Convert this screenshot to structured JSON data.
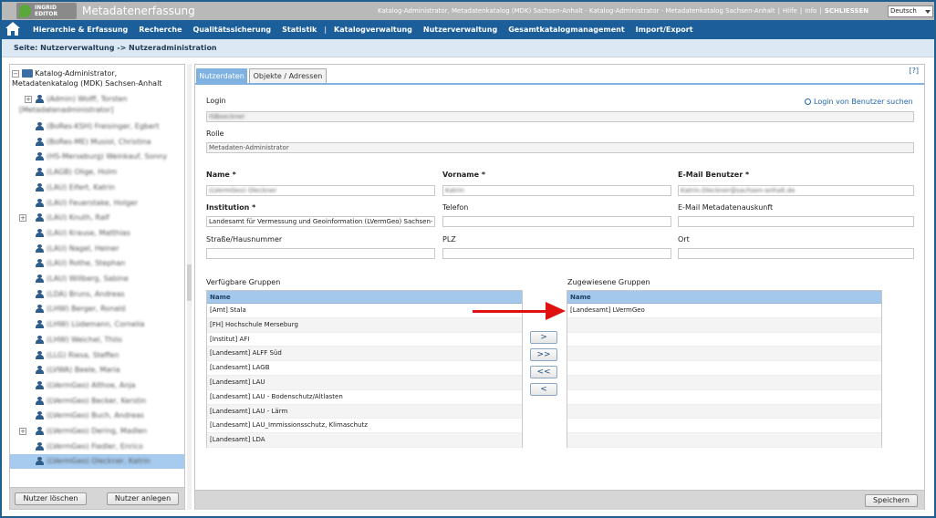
{
  "header": {
    "logo_line1": "INGRID",
    "logo_line2": "EDITOR",
    "app_title": "Metadatenerfassung",
    "user_info": "Katalog-Administrator, Metadatenkatalog (MDK) Sachsen-Anhalt - Katalog-Administrator - Metadatenkatalog Sachsen-Anhalt",
    "help_link": "Hilfe",
    "info_link": "Info",
    "close_link": "SCHLIESSEN",
    "language": "Deutsch"
  },
  "nav": {
    "items": [
      "Hierarchie & Erfassung",
      "Recherche",
      "Qualitätssicherung",
      "Statistik",
      "Katalogverwaltung",
      "Nutzerverwaltung",
      "Gesamtkatalogmanagement",
      "Import/Export"
    ]
  },
  "page": {
    "title": "Seite: Nutzerverwaltung -> Nutzeradministration"
  },
  "tree": {
    "root_label_1": "Katalog-Administrator,",
    "root_label_2": "Metadatenkatalog (MDK) Sachsen-Anhalt",
    "first_item_line1": "(Admin) Wolff, Torsten",
    "first_item_line2": "[Metadatenadministrator]",
    "items": [
      {
        "label": "(BoRes-KSH) Freisinger, Egbert",
        "expandable": false
      },
      {
        "label": "(BoRes-ME) Musiol, Christina",
        "expandable": false
      },
      {
        "label": "(HS-Merseburg) Weinkauf, Sonny",
        "expandable": false
      },
      {
        "label": "(LAGB) Olige, Holm",
        "expandable": false
      },
      {
        "label": "(LAU) Eifert, Katrin",
        "expandable": false
      },
      {
        "label": "(LAU) Feuerstake, Holger",
        "expandable": false
      },
      {
        "label": "(LAU) Knuth, Ralf",
        "expandable": true
      },
      {
        "label": "(LAU) Krause, Matthias",
        "expandable": false
      },
      {
        "label": "(LAU) Nagel, Heiner",
        "expandable": false
      },
      {
        "label": "(LAU) Rothe, Stephan",
        "expandable": false
      },
      {
        "label": "(LAU) Willberg, Sabine",
        "expandable": false
      },
      {
        "label": "(LDA) Bruns, Andreas",
        "expandable": false
      },
      {
        "label": "(LHW) Berger, Ronald",
        "expandable": false
      },
      {
        "label": "(LHW) Lüdemann, Cornelia",
        "expandable": false
      },
      {
        "label": "(LHW) Weichel, Thilo",
        "expandable": false
      },
      {
        "label": "(LLG) Riesa, Steffen",
        "expandable": false
      },
      {
        "label": "(LVWA) Beele, Maria",
        "expandable": false
      },
      {
        "label": "(LVermGeo) Althoe, Anja",
        "expandable": false
      },
      {
        "label": "(LVermGeo) Becker, Kerstin",
        "expandable": false
      },
      {
        "label": "(LVermGeo) Buch, Andreas",
        "expandable": false
      },
      {
        "label": "(LVermGeo) Dering, Madlen",
        "expandable": true
      },
      {
        "label": "(LVermGeo) Fiedler, Enrico",
        "expandable": false
      },
      {
        "label": "(LVermGeo) Oleckner, Katrin",
        "expandable": false,
        "selected": true
      }
    ],
    "delete_button": "Nutzer löschen",
    "create_button": "Nutzer anlegen"
  },
  "tabs": {
    "active": "Nutzerdaten",
    "inactive": "Objekte / Adressen",
    "help": "[?]"
  },
  "form": {
    "login_label": "Login",
    "login_value": "ISBoeckner",
    "search_login_link": "Login von Benutzer suchen",
    "role_label": "Rolle",
    "role_value": "Metadaten-Administrator",
    "name_label": "Name *",
    "name_value": "(LVermGeo) Oleckner",
    "firstname_label": "Vorname *",
    "firstname_value": "Katrin",
    "email_label": "E-Mail Benutzer *",
    "email_value": "Katrin.Oleckner@sachsen-anhalt.de",
    "institution_label": "Institution *",
    "institution_value": "Landesamt für Vermessung und Geoinformation (LVermGeo) Sachsen-",
    "phone_label": "Telefon",
    "phone_value": "",
    "email_meta_label": "E-Mail Metadatenauskunft",
    "email_meta_value": "",
    "street_label": "Straße/Hausnummer",
    "street_value": "",
    "plz_label": "PLZ",
    "plz_value": "",
    "city_label": "Ort",
    "city_value": ""
  },
  "groups": {
    "available_label": "Verfügbare Gruppen",
    "assigned_label": "Zugewiesene Gruppen",
    "column_header": "Name",
    "available": [
      "[Amt] Stala",
      "[FH] Hochschule Merseburg",
      "[Institut] AFI",
      "[Landesamt] ALFF Süd",
      "[Landesamt] LAGB",
      "[Landesamt] LAU",
      "[Landesamt] LAU - Bodenschutz/Altlasten",
      "[Landesamt] LAU - Lärm",
      "[Landesamt] LAU_Immissionsschutz, Klimaschutz",
      "[Landesamt] LDA"
    ],
    "assigned": [
      "[Landesamt] LVermGeo"
    ],
    "btn_add": ">",
    "btn_add_all": ">>",
    "btn_remove_all": "<<",
    "btn_remove": "<"
  },
  "footer": {
    "save_button": "Speichern"
  },
  "colors": {
    "nav_bg": "#1b5e9a",
    "tab_active": "#7fb2e0",
    "table_header": "#a3c8ec",
    "arrow": "#e01010"
  }
}
